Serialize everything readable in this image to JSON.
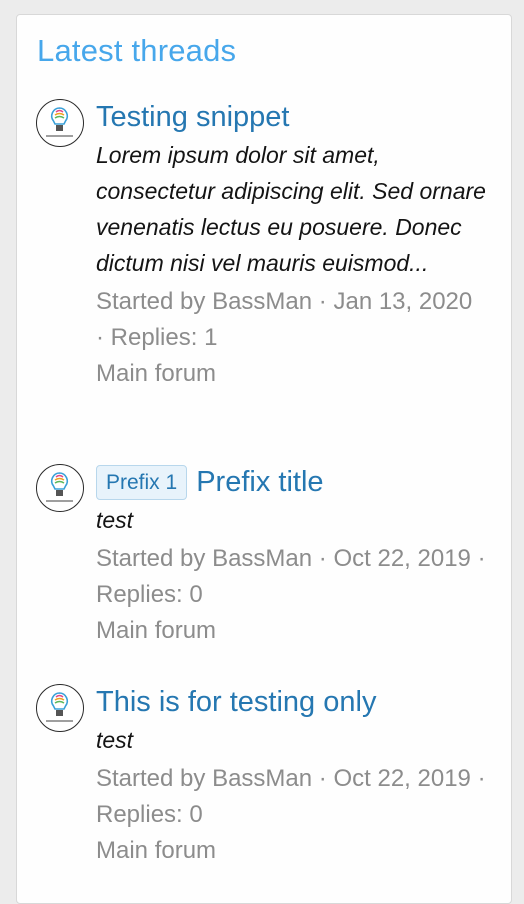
{
  "widget": {
    "title": "Latest threads"
  },
  "threads": [
    {
      "prefix": "",
      "title": "Testing snippet",
      "snippet": "Lorem ipsum dolor sit amet, consectetur adipiscing elit. Sed ornare venenatis lectus eu posuere. Donec dictum nisi vel mauris euismod...",
      "started_by_label": "Started by",
      "author": "BassMan",
      "separator": "·",
      "date": "Jan 13, 2020",
      "replies_label": "Replies:",
      "replies": "1",
      "forum": "Main forum"
    },
    {
      "prefix": "Prefix 1",
      "title": "Prefix title",
      "snippet": "test",
      "started_by_label": "Started by",
      "author": "BassMan",
      "separator": "·",
      "date": "Oct 22, 2019",
      "replies_label": "Replies:",
      "replies": "0",
      "forum": "Main forum"
    },
    {
      "prefix": "",
      "title": "This is for testing only",
      "snippet": "test",
      "started_by_label": "Started by",
      "author": "BassMan",
      "separator": "·",
      "date": "Oct 22, 2019",
      "replies_label": "Replies:",
      "replies": "0",
      "forum": "Main forum"
    }
  ],
  "colors": {
    "title": "#47a7eb",
    "link": "#2577b1",
    "muted": "#8c8c8c",
    "prefix_bg": "#e8f3fb"
  },
  "icons": {
    "avatar": "lightbulb-logo-icon"
  }
}
